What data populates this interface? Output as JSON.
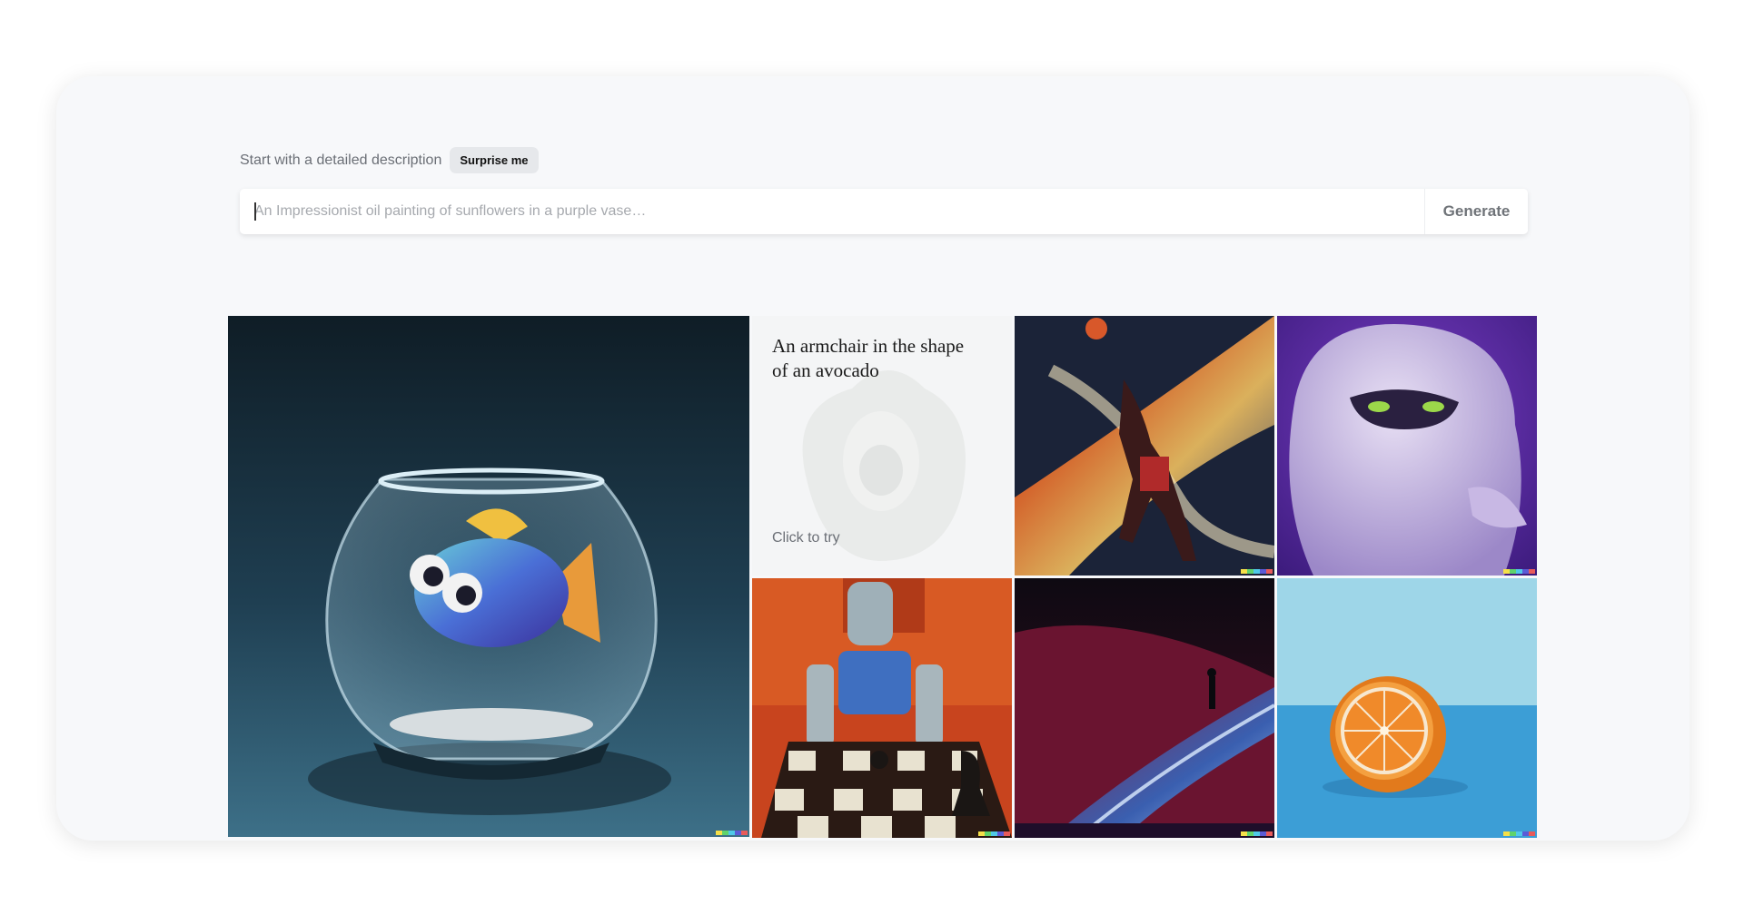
{
  "prompt": {
    "hint": "Start with a detailed description",
    "surprise_label": "Surprise me",
    "placeholder": "An Impressionist oil painting of sunflowers in a purple vase…",
    "value": "",
    "generate_label": "Generate"
  },
  "gallery": {
    "featured_prompt": {
      "title": "An armchair in the shape of an avocado",
      "cta": "Click to try"
    },
    "badge_colors": [
      "#f5e04a",
      "#5fd36c",
      "#4fc9e8",
      "#5b5bd6",
      "#e85b5b"
    ],
    "images": [
      {
        "subject": "fishbowl",
        "icon": "fish-in-bowl-image"
      },
      {
        "subject": "cosmic basketball dunk",
        "icon": "basketball-painting-image"
      },
      {
        "subject": "purple furry monster",
        "icon": "monster-image"
      },
      {
        "subject": "robot playing chess",
        "icon": "robot-chess-image"
      },
      {
        "subject": "figure on glowing dune",
        "icon": "dune-image"
      },
      {
        "subject": "orange half",
        "icon": "orange-image"
      }
    ]
  }
}
